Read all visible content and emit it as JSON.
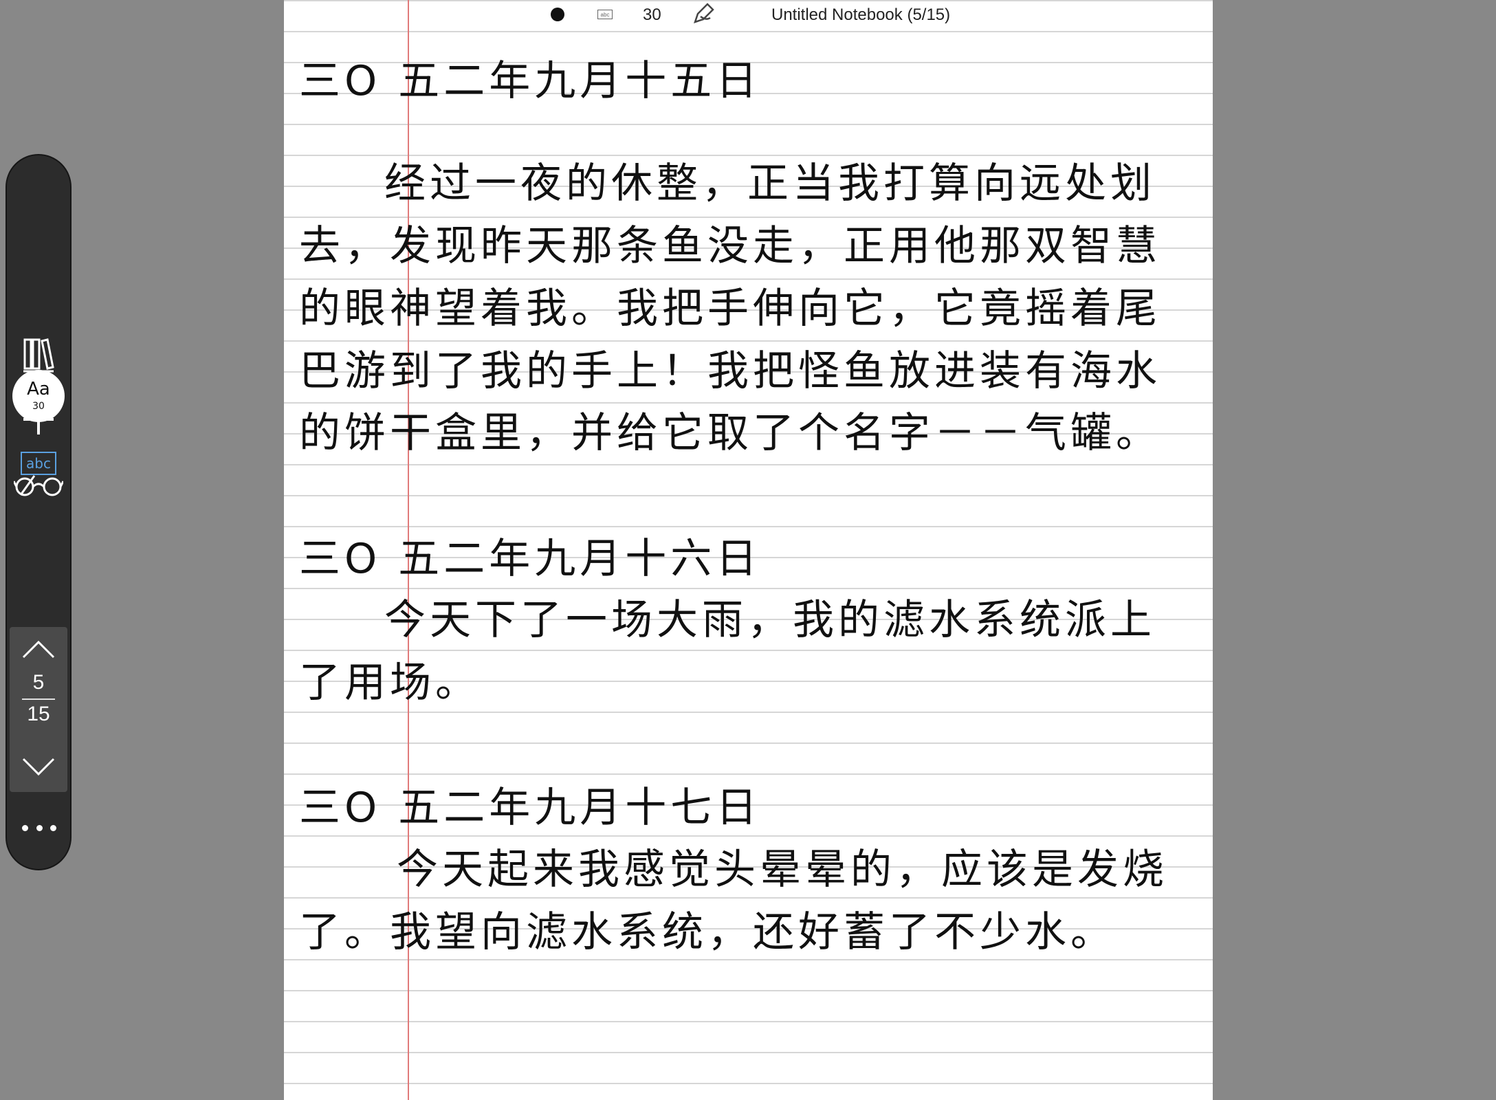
{
  "toolbar": {
    "font_size_icon": "Aa",
    "font_size_value": "30",
    "abc_label": "abc",
    "current_page": "5",
    "total_pages": "15",
    "icons": [
      "library-icon",
      "add-icon",
      "glasses-icon",
      "font-size-icon",
      "abc-icon",
      "pen-icon",
      "undo-icon",
      "page-up-icon",
      "page-down-icon",
      "more-icon"
    ]
  },
  "status_bar": {
    "mini_abc": "abc",
    "font_size": "30",
    "notebook_title": "Untitled Notebook (5/15)"
  },
  "notebook": {
    "entries": [
      {
        "date": "三O 五二年九月十五日",
        "lines": [
          "经过一夜的休整，正当我打算向远处划",
          "去，发现昨天那条鱼没走，正用他那双智慧",
          "的眼神望着我。我把手伸向它，它竟摇着尾",
          "巴游到了我的手上！我把怪鱼放进装有海水",
          "的饼干盒里，并给它取了个名字－－气罐。"
        ]
      },
      {
        "date": "三O 五二年九月十六日",
        "lines": [
          "今天下了一场大雨，我的滤水系统派上",
          "了用场。"
        ]
      },
      {
        "date": "三O 五二年九月十七日",
        "lines": [
          "今天起来我感觉头晕晕的，应该是发烧",
          "了。我望向滤水系统，还好蓄了不少水。"
        ]
      }
    ]
  },
  "colors": {
    "background": "#888888",
    "toolbar": "#2c2c2c",
    "paper": "#ffffff",
    "rule_line": "#d6d6d6",
    "margin_line": "#e07a7a",
    "accent": "#5aa0e0"
  }
}
